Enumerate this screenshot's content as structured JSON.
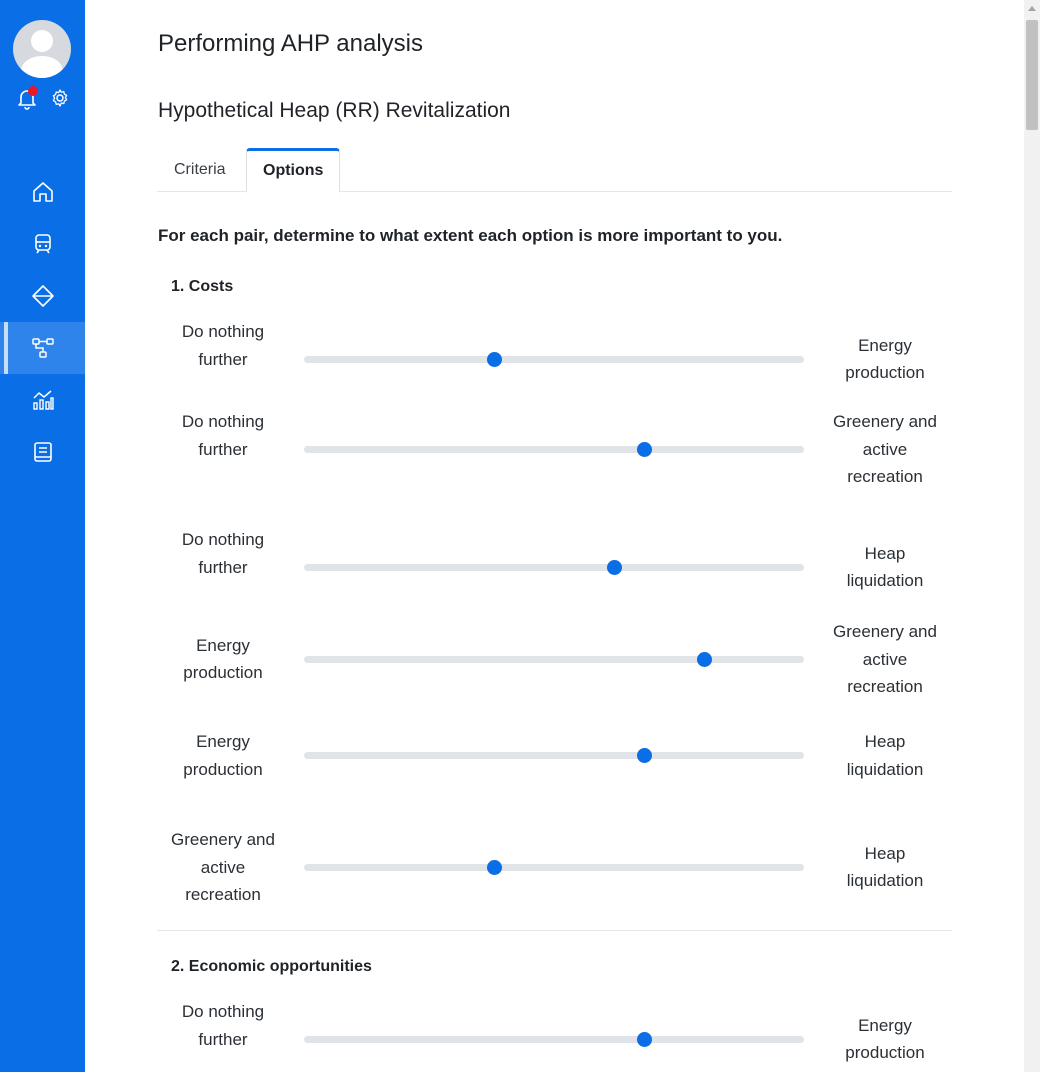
{
  "sidebar": {
    "nav_items": [
      {
        "icon": "home-icon",
        "active": false
      },
      {
        "icon": "train-icon",
        "active": false
      },
      {
        "icon": "directions-icon",
        "active": false
      },
      {
        "icon": "flow-diagram-icon",
        "active": true
      },
      {
        "icon": "chart-analytics-icon",
        "active": false
      },
      {
        "icon": "notebook-icon",
        "active": false
      }
    ],
    "notification_dot_color": "#e8192c"
  },
  "header": {
    "page_title": "Performing AHP analysis",
    "project_title": "Hypothetical Heap (RR) Revitalization"
  },
  "tabs": [
    {
      "label": "Criteria",
      "active": false
    },
    {
      "label": "Options",
      "active": true
    }
  ],
  "instruction": "For each pair, determine to what extent each option is more important to you.",
  "sections": [
    {
      "title": "1. Costs",
      "comparisons": [
        {
          "left": "Do nothing further",
          "right": "Energy production",
          "value": 0.38
        },
        {
          "left": "Do nothing further",
          "right": "Greenery and active recreation",
          "value": 0.68
        },
        {
          "left": "Do nothing further",
          "right": "Heap liquidation",
          "value": 0.62
        },
        {
          "left": "Energy production",
          "right": "Greenery and active recreation",
          "value": 0.8
        },
        {
          "left": "Energy production",
          "right": "Heap liquidation",
          "value": 0.68
        },
        {
          "left": "Greenery and active recreation",
          "right": "Heap liquidation",
          "value": 0.38
        }
      ]
    },
    {
      "title": "2. Economic opportunities",
      "comparisons": [
        {
          "left": "Do nothing further",
          "right": "Energy production",
          "value": 0.68
        }
      ]
    }
  ],
  "colors": {
    "sidebar": "#0a6ee6",
    "accent": "#0a6ee6",
    "track": "#e0e3e8"
  }
}
